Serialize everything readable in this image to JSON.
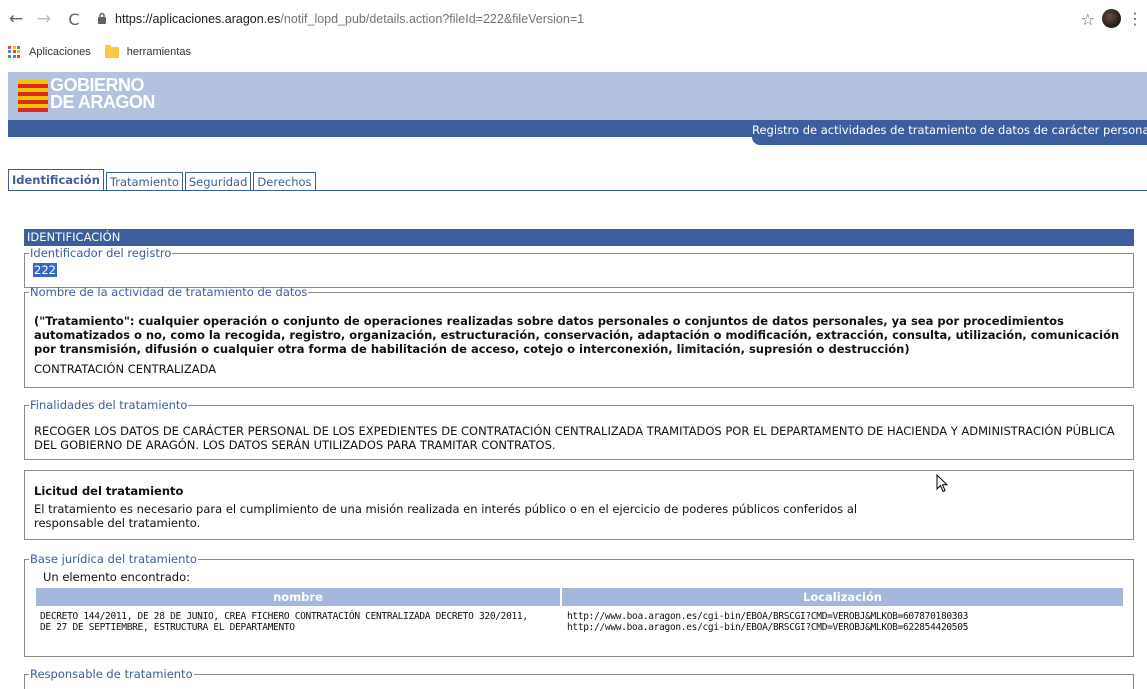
{
  "browser": {
    "url_host": "https://aplicaciones.aragon.es",
    "url_path": "/notif_lopd_pub/details.action?fileId=222&fileVersion=1",
    "bookmarks": [
      {
        "label": "Aplicaciones",
        "icon": "apps-grid-icon"
      },
      {
        "label": "herramientas",
        "icon": "folder-icon"
      }
    ]
  },
  "header": {
    "logo_line1": "GOBIERNO",
    "logo_line2": "DE ARAGON",
    "subtitle": "Registro de actividades de tratamiento de datos de carácter personal",
    "colors": {
      "banner": "#b1c1de",
      "navy": "#3d5e9d",
      "flag_yellow": "#f5c400",
      "flag_red": "#d82a20"
    }
  },
  "tabs": [
    {
      "label": "Identificación",
      "active": true
    },
    {
      "label": "Tratamiento",
      "active": false
    },
    {
      "label": "Seguridad",
      "active": false
    },
    {
      "label": "Derechos",
      "active": false
    }
  ],
  "main": {
    "section_title": "IDENTIFICACIÓN",
    "identificador": {
      "legend": "Identificador del registro",
      "value": "222"
    },
    "nombre": {
      "legend": "Nombre de la actividad de tratamiento de datos",
      "definition": "(\"Tratamiento\": cualquier operación o conjunto de operaciones realizadas sobre datos personales o conjuntos de datos personales, ya sea por procedimientos automatizados o no, como la recogida, registro, organización, estructuración, conservación, adaptación o modificación, extracción, consulta, utilización, comunicación por transmisión, difusión o cualquier otra forma de habilitación de acceso, cotejo o interconexión, limitación, supresión o destrucción)",
      "value": "CONTRATACIÓN CENTRALIZADA"
    },
    "finalidades": {
      "legend": "Finalidades del tratamiento",
      "value": "RECOGER LOS DATOS DE CARÁCTER PERSONAL DE LOS EXPEDIENTES DE CONTRATACIÓN CENTRALIZADA TRAMITADOS POR EL DEPARTAMENTO DE HACIENDA Y ADMINISTRACIÓN PÚBLICA DEL GOBIERNO DE ARAGÓN. LOS DATOS SERÁN UTILIZADOS PARA TRAMITAR CONTRATOS."
    },
    "licitud": {
      "title": "Licitud del tratamiento",
      "value_line1": "El tratamiento es necesario para el cumplimiento de una misión realizada en interés público o en el ejercicio de poderes públicos conferidos al",
      "value_line2": "responsable del tratamiento."
    },
    "base": {
      "legend": "Base jurídica del tratamiento",
      "count_text": "Un elemento encontrado:",
      "columns": [
        "nombre",
        "Localización"
      ],
      "rows": [
        {
          "nombre_line1": "DECRETO 144/2011, DE 28 DE JUNIO, CREA FICHERO CONTRATACIÓN CENTRALIZADA DECRETO 320/2011,",
          "nombre_line2": "DE 27 DE SEPTIEMBRE, ESTRUCTURA EL DEPARTAMENTO",
          "loc_line1": "http://www.boa.aragon.es/cgi-bin/EBOA/BRSCGI?CMD=VEROBJ&MLKOB=607870180303",
          "loc_line2": "http://www.boa.aragon.es/cgi-bin/EBOA/BRSCGI?CMD=VEROBJ&MLKOB=622854420505"
        }
      ]
    },
    "responsable": {
      "legend": "Responsable de tratamiento"
    }
  }
}
